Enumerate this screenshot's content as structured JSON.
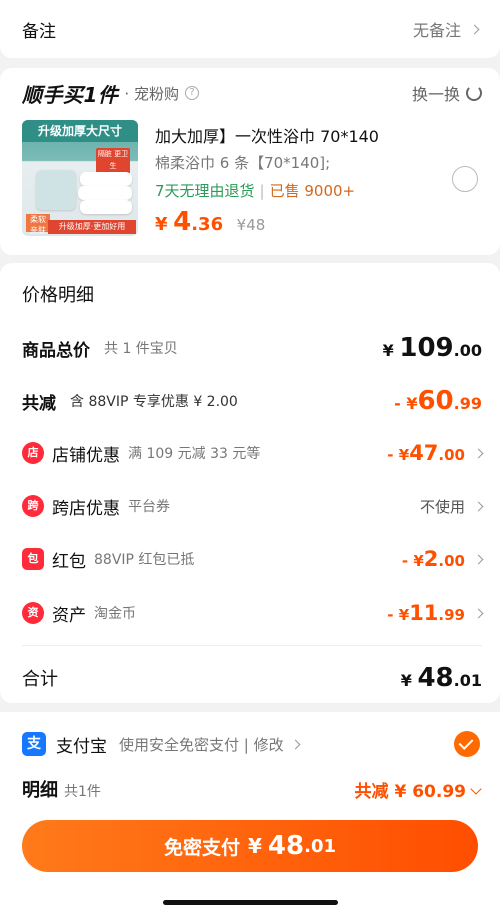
{
  "remark": {
    "label": "备注",
    "value": "无备注"
  },
  "shunshou": {
    "logo": "顺手买1件",
    "sub": "宠粉购",
    "swap": "换一换",
    "product": {
      "image_banner": "升级加厚大尺寸",
      "image_badge": "隔脏 更卫生",
      "image_tag": "柔软 亲肤",
      "image_bottom": "升级加厚·更加好用",
      "title": "加大加厚】一次性浴巾 70*140",
      "spec": "棉柔浴巾 6 条【70*140];",
      "return_policy": "7天无理由退货",
      "sold": "已售 9000+",
      "price_yen": "¥",
      "price_int": "4",
      "price_dec": ".36",
      "orig_price": "¥48"
    }
  },
  "price_detail": {
    "title": "价格明细",
    "goods_total": {
      "name": "商品总价",
      "desc": "共 1 件宝贝",
      "yen": "¥",
      "int": "109",
      "dec": ".00"
    },
    "discount_total": {
      "name": "共减",
      "desc": "含 88VIP 专享优惠 ¥ 2.00",
      "prefix": "- ¥",
      "int": "60",
      "dec": ".99"
    },
    "items": [
      {
        "icon": "店",
        "name": "店铺优惠",
        "desc": "满 109 元减 33 元等",
        "prefix": "- ¥",
        "int": "47",
        "dec": ".00"
      },
      {
        "icon": "跨",
        "name": "跨店优惠",
        "desc": "平台券",
        "value": "不使用"
      },
      {
        "icon": "包",
        "name": "红包",
        "desc": "88VIP 红包已抵",
        "prefix": "- ¥",
        "int": "2",
        "dec": ".00"
      },
      {
        "icon": "资",
        "name": "资产",
        "desc": "淘金币",
        "prefix": "- ¥",
        "int": "11",
        "dec": ".99"
      }
    ],
    "total": {
      "name": "合计",
      "yen": "¥",
      "int": "48",
      "dec": ".01"
    }
  },
  "payment": {
    "method": "支付宝",
    "desc": "使用安全免密支付 | 修改",
    "detail_label": "明细",
    "detail_count": "共1件",
    "detail_saved": "共减 ¥ 60.99",
    "button_text": "免密支付",
    "button_yen": "¥",
    "button_int": "48",
    "button_dec": ".01"
  },
  "colors": {
    "accent": "#ff5000",
    "alipay": "#1677ff",
    "green": "#2c9b5a"
  }
}
